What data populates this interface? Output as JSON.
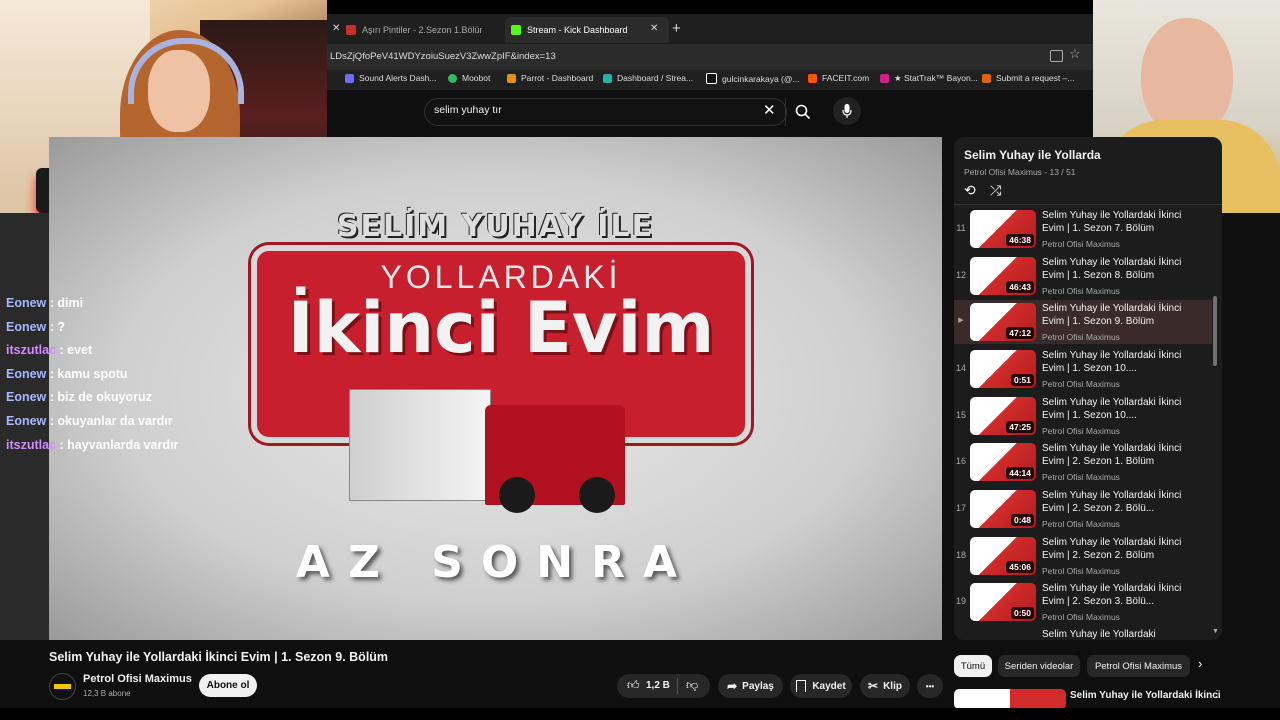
{
  "browser": {
    "tabs": [
      {
        "title": "Aşırı Pintiler - 2.Sezon 1.Bölüm - Y"
      },
      {
        "title": "Stream - Kick Dashboard"
      }
    ],
    "new_tab_glyph": "+",
    "url": "LDsZjQfoPeV41WDYzoiuSuezV3ZwwZpIF&index=13",
    "bookmarks": [
      {
        "label": "Sound Alerts Dash..."
      },
      {
        "label": "Moobot"
      },
      {
        "label": "Parrot - Dashboard"
      },
      {
        "label": "Dashboard / Strea..."
      },
      {
        "label": "gulcinkarakaya (@..."
      },
      {
        "label": "FACEIT.com"
      },
      {
        "label": "★ StatTrak™ Bayon..."
      },
      {
        "label": "Submit a request –..."
      }
    ]
  },
  "search": {
    "value": "selim yuhay tır"
  },
  "video": {
    "overlay_top": "SELİM YUHAY İLE",
    "overlay_mid1": "YOLLARDAKİ",
    "overlay_mid2": "İkinci Evim",
    "overlay_bottom": "AZ SONRA",
    "title": "Selim Yuhay ile Yollardaki İkinci Evim | 1. Sezon 9. Bölüm",
    "channel": "Petrol Ofisi Maximus",
    "subscribers": "12,3 B abone",
    "subscribe_label": "Abone ol",
    "like_count": "1,2 B",
    "share_label": "Paylaş",
    "save_label": "Kaydet",
    "clip_label": "Klip",
    "more_glyph": "•••"
  },
  "chat": [
    {
      "user": "Eonew",
      "text": "dimi"
    },
    {
      "user": "Eonew",
      "text": "?"
    },
    {
      "user": "itszutlac",
      "text": "evet"
    },
    {
      "user": "Eonew",
      "text": "kamu spotu"
    },
    {
      "user": "Eonew",
      "text": "biz de okuyoruz"
    },
    {
      "user": "Eonew",
      "text": "okuyanlar da vardır"
    },
    {
      "user": "itszutlac",
      "text": "hayvanlarda vardır"
    }
  ],
  "playlist": {
    "title": "Selim Yuhay ile Yollarda",
    "subtitle": "Petrol Ofisi Maximus - 13 / 51",
    "items": [
      {
        "num": "11",
        "title": "Selim Yuhay ile Yollardaki İkinci Evim | 1. Sezon 7. Bölüm",
        "channel": "Petrol Ofisi Maximus",
        "duration": "46:38"
      },
      {
        "num": "12",
        "title": "Selim Yuhay ile Yollardaki İkinci Evim | 1. Sezon 8. Bölüm",
        "channel": "Petrol Ofisi Maximus",
        "duration": "46:43"
      },
      {
        "num": "▶",
        "title": "Selim Yuhay ile Yollardaki İkinci Evim | 1. Sezon 9. Bölüm",
        "channel": "Petrol Ofisi Maximus",
        "duration": "47:12"
      },
      {
        "num": "14",
        "title": "Selim Yuhay ile Yollardaki İkinci Evim | 1. Sezon 10....",
        "channel": "Petrol Ofisi Maximus",
        "duration": "0:51"
      },
      {
        "num": "15",
        "title": "Selim Yuhay ile Yollardaki İkinci Evim | 1. Sezon 10....",
        "channel": "Petrol Ofisi Maximus",
        "duration": "47:25"
      },
      {
        "num": "16",
        "title": "Selim Yuhay ile Yollardaki İkinci Evim | 2. Sezon 1. Bölüm",
        "channel": "Petrol Ofisi Maximus",
        "duration": "44:14"
      },
      {
        "num": "17",
        "title": "Selim Yuhay ile Yollardaki İkinci Evim | 2. Sezon 2. Bölü...",
        "channel": "Petrol Ofisi Maximus",
        "duration": "0:48"
      },
      {
        "num": "18",
        "title": "Selim Yuhay ile Yollardaki İkinci Evim | 2. Sezon 2. Bölüm",
        "channel": "Petrol Ofisi Maximus",
        "duration": "45:06"
      },
      {
        "num": "19",
        "title": "Selim Yuhay ile Yollardaki İkinci Evim | 2. Sezon 3. Bölü...",
        "channel": "Petrol Ofisi Maximus",
        "duration": "0:50"
      }
    ],
    "partial_title": "Selim Yuhay ile Yollardaki"
  },
  "chips": [
    {
      "label": "Tümü"
    },
    {
      "label": "Seriden videolar"
    },
    {
      "label": "Petrol Ofisi Maximus"
    }
  ],
  "next_video": {
    "title": "Selim Yuhay ile Yollardaki İkinci"
  }
}
